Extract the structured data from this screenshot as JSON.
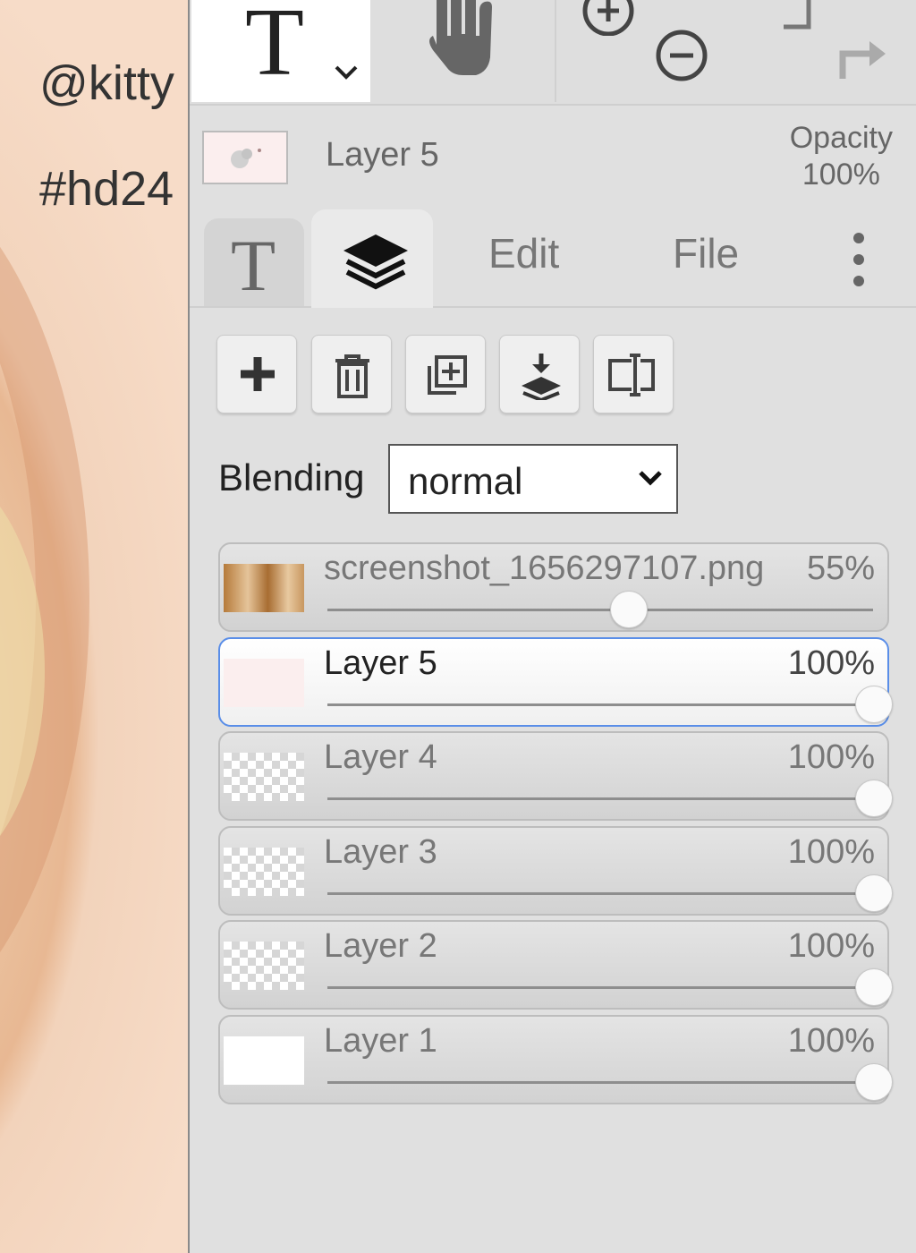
{
  "canvas": {
    "lines": [
      "@kitty",
      "#hd24"
    ]
  },
  "toolbar": {
    "icons": [
      "text-tool-icon",
      "chevron-down-icon",
      "hand-icon",
      "zoom-in-icon",
      "zoom-out-icon",
      "undo-icon",
      "redo-icon"
    ]
  },
  "info": {
    "layer_name": "Layer 5",
    "opacity_label": "Opacity",
    "opacity_value": "100%"
  },
  "tabs": {
    "edit": "Edit",
    "file": "File"
  },
  "blending": {
    "label": "Blending",
    "value": "normal"
  },
  "layers": [
    {
      "name": "screenshot_1656297107.png",
      "opacity": "55%",
      "level": 0.55,
      "thumb": "photo",
      "active": false
    },
    {
      "name": "Layer 5",
      "opacity": "100%",
      "level": 1.0,
      "thumb": "pinkish",
      "active": true
    },
    {
      "name": "Layer 4",
      "opacity": "100%",
      "level": 1.0,
      "thumb": "checker",
      "active": false
    },
    {
      "name": "Layer 3",
      "opacity": "100%",
      "level": 1.0,
      "thumb": "checker",
      "active": false
    },
    {
      "name": "Layer 2",
      "opacity": "100%",
      "level": 1.0,
      "thumb": "checker",
      "active": false
    },
    {
      "name": "Layer 1",
      "opacity": "100%",
      "level": 1.0,
      "thumb": "white",
      "active": false
    }
  ],
  "colors": {
    "active_border": "#5a8ee8",
    "panel_bg": "#e0e0e0"
  }
}
